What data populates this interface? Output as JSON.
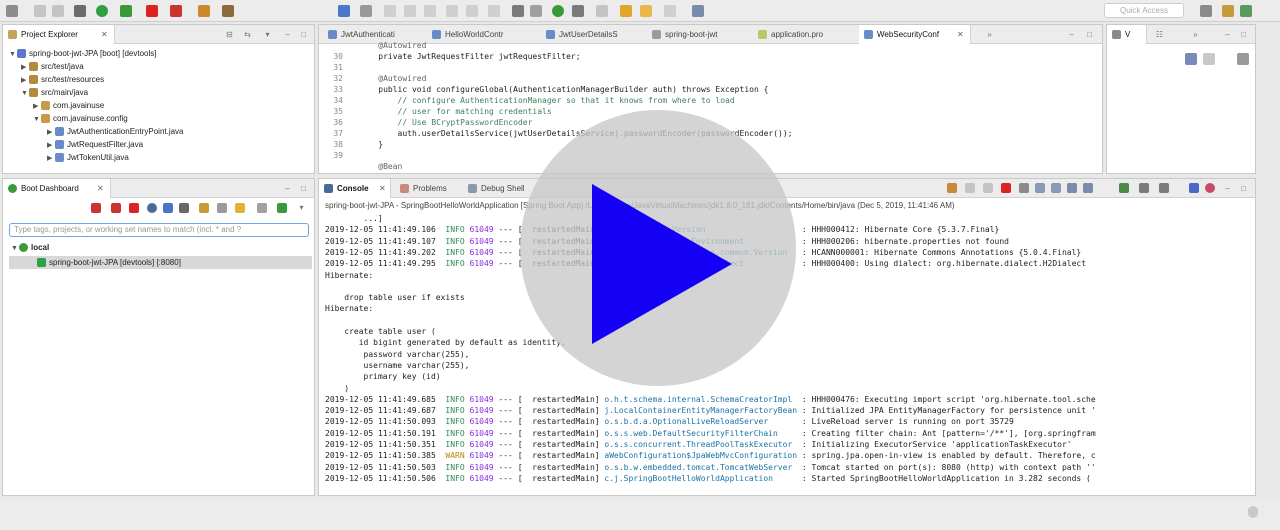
{
  "toolbar": {
    "quick_access_placeholder": "Quick Access"
  },
  "project_explorer": {
    "tab_label": "Project Explorer",
    "items": [
      {
        "label": "spring-boot-jwt-JPA [boot] [devtools]"
      },
      {
        "label": "src/test/java"
      },
      {
        "label": "src/test/resources"
      },
      {
        "label": "src/main/java"
      },
      {
        "label": "com.javainuse"
      },
      {
        "label": "com.javainuse.config"
      },
      {
        "label": "JwtAuthenticationEntryPoint.java"
      },
      {
        "label": "JwtRequestFilter.java"
      },
      {
        "label": "JwtTokenUtil.java"
      }
    ]
  },
  "editor": {
    "tabs": [
      {
        "label": "JwtAuthenticati"
      },
      {
        "label": "HelloWorldContr"
      },
      {
        "label": "JwtUserDetailsS"
      },
      {
        "label": "spring-boot-jwt"
      },
      {
        "label": "application.pro"
      },
      {
        "label": "WebSecurityConf"
      }
    ],
    "lines": [
      {
        "num": "",
        "text": "    @Autowired"
      },
      {
        "num": "30",
        "text": "    private JwtRequestFilter jwtRequestFilter;"
      },
      {
        "num": "31",
        "text": ""
      },
      {
        "num": "32",
        "text": "    @Autowired"
      },
      {
        "num": "33",
        "text": "    public void configureGlobal(AuthenticationManagerBuilder auth) throws Exception {"
      },
      {
        "num": "34",
        "text": "        // configure AuthenticationManager so that it knows from where to load"
      },
      {
        "num": "35",
        "text": "        // user for matching credentials"
      },
      {
        "num": "36",
        "text": "        // Use BCryptPasswordEncoder"
      },
      {
        "num": "37",
        "text": "        auth.userDetailsService(jwtUserDetailsService).passwordEncoder(passwordEncoder());"
      },
      {
        "num": "38",
        "text": "    }"
      },
      {
        "num": "39",
        "text": ""
      },
      {
        "num": "",
        "text": "    @Bean"
      }
    ]
  },
  "outline": {
    "tab_label": "V"
  },
  "boot_dashboard": {
    "tab_label": "Boot Dashboard",
    "filter_placeholder": "Type tags, projects, or working set names to match (incl. * and ?",
    "local_label": "local",
    "app_label": "spring-boot-jwt-JPA [devtools] [:8080]"
  },
  "console": {
    "tabs": [
      {
        "label": "Console"
      },
      {
        "label": "Problems"
      },
      {
        "label": "Debug Shell"
      }
    ],
    "header": "spring-boot-jwt-JPA - SpringBootHelloWorldApplication [Spring Boot App] /Library/Java/JavaVirtualMachines/jdk1.8.0_181.jdk/Contents/Home/bin/java (Dec 5, 2019, 11:41:46 AM)",
    "lines": [
      "        ...]",
      "2019-12-05 11:41:49.106  INFO 61049 --- [  restartedMain] org.hibernate.Version                    : HHH000412: Hibernate Core {5.3.7.Final}",
      "2019-12-05 11:41:49.107  INFO 61049 --- [  restartedMain] org.hibernate.cfg.Environment            : HHH000206: hibernate.properties not found",
      "2019-12-05 11:41:49.202  INFO 61049 --- [  restartedMain] o.hibernate.annotations.common.Version   : HCANN000001: Hibernate Commons Annotations {5.0.4.Final}",
      "2019-12-05 11:41:49.295  INFO 61049 --- [  restartedMain] org.hibernate.dialect.Dialect            : HHH000400: Using dialect: org.hibernate.dialect.H2Dialect",
      "Hibernate:",
      "",
      "    drop table user if exists",
      "Hibernate:",
      "",
      "    create table user (",
      "       id bigint generated by default as identity,",
      "        password varchar(255),",
      "        username varchar(255),",
      "        primary key (id)",
      "    )",
      "2019-12-05 11:41:49.685  INFO 61049 --- [  restartedMain] o.h.t.schema.internal.SchemaCreatorImpl  : HHH000476: Executing import script 'org.hibernate.tool.sche",
      "2019-12-05 11:41:49.687  INFO 61049 --- [  restartedMain] j.LocalContainerEntityManagerFactoryBean : Initialized JPA EntityManagerFactory for persistence unit '",
      "2019-12-05 11:41:50.093  INFO 61049 --- [  restartedMain] o.s.b.d.a.OptionalLiveReloadServer       : LiveReload server is running on port 35729",
      "2019-12-05 11:41:50.191  INFO 61049 --- [  restartedMain] o.s.s.web.DefaultSecurityFilterChain     : Creating filter chain: Ant [pattern='/**'], [org.springfram",
      "2019-12-05 11:41:50.351  INFO 61049 --- [  restartedMain] o.s.s.concurrent.ThreadPoolTaskExecutor  : Initializing ExecutorService 'applicationTaskExecutor'",
      "2019-12-05 11:41:50.385  WARN 61049 --- [  restartedMain] aWebConfiguration$JpaWebMvcConfiguration : spring.jpa.open-in-view is enabled by default. Therefore, c",
      "2019-12-05 11:41:50.503  INFO 61049 --- [  restartedMain] o.s.b.w.embedded.tomcat.TomcatWebServer  : Tomcat started on port(s): 8080 (http) with context path ''",
      "2019-12-05 11:41:50.506  INFO 61049 --- [  restartedMain] c.j.SpringBootHelloWorldApplication      : Started SpringBootHelloWorldApplication in 3.282 seconds ("
    ]
  },
  "colors": {
    "play_triangle": "#1400f5",
    "play_circle": "#c8c8c8"
  }
}
